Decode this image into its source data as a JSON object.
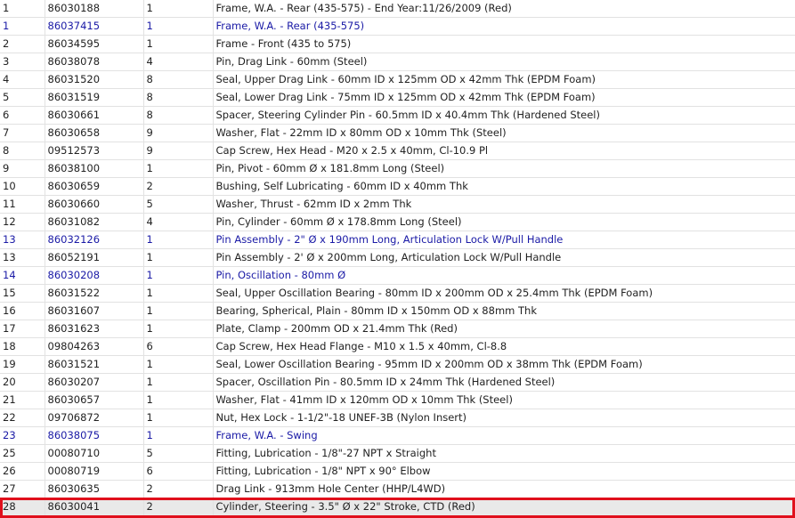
{
  "rows": [
    {
      "ref": "1",
      "part": "86030188",
      "qty": "1",
      "desc": "Frame, W.A. - Rear (435-575) - End Year:11/26/2009 (Red)",
      "linked": false
    },
    {
      "ref": "1",
      "part": "86037415",
      "qty": "1",
      "desc": "Frame, W.A. - Rear (435-575)",
      "linked": true
    },
    {
      "ref": "2",
      "part": "86034595",
      "qty": "1",
      "desc": "Frame - Front (435 to 575)",
      "linked": false
    },
    {
      "ref": "3",
      "part": "86038078",
      "qty": "4",
      "desc": "Pin, Drag Link - 60mm (Steel)",
      "linked": false
    },
    {
      "ref": "4",
      "part": "86031520",
      "qty": "8",
      "desc": "Seal, Upper Drag Link - 60mm ID x 125mm OD x 42mm Thk (EPDM Foam)",
      "linked": false
    },
    {
      "ref": "5",
      "part": "86031519",
      "qty": "8",
      "desc": "Seal, Lower Drag Link - 75mm ID x 125mm OD x 42mm Thk (EPDM Foam)",
      "linked": false
    },
    {
      "ref": "6",
      "part": "86030661",
      "qty": "8",
      "desc": "Spacer, Steering Cylinder Pin - 60.5mm ID x 40.4mm Thk (Hardened Steel)",
      "linked": false
    },
    {
      "ref": "7",
      "part": "86030658",
      "qty": "9",
      "desc": "Washer, Flat - 22mm ID x 80mm OD x 10mm Thk (Steel)",
      "linked": false
    },
    {
      "ref": "8",
      "part": "09512573",
      "qty": "9",
      "desc": "Cap Screw, Hex Head - M20 x 2.5 x 40mm, Cl-10.9 Pl",
      "linked": false
    },
    {
      "ref": "9",
      "part": "86038100",
      "qty": "1",
      "desc": "Pin, Pivot - 60mm Ø x 181.8mm Long (Steel)",
      "linked": false
    },
    {
      "ref": "10",
      "part": "86030659",
      "qty": "2",
      "desc": "Bushing, Self Lubricating - 60mm ID x 40mm Thk",
      "linked": false
    },
    {
      "ref": "11",
      "part": "86030660",
      "qty": "5",
      "desc": "Washer, Thrust - 62mm ID x 2mm Thk",
      "linked": false
    },
    {
      "ref": "12",
      "part": "86031082",
      "qty": "4",
      "desc": "Pin, Cylinder - 60mm Ø x 178.8mm Long (Steel)",
      "linked": false
    },
    {
      "ref": "13",
      "part": "86032126",
      "qty": "1",
      "desc": "Pin Assembly - 2\" Ø x 190mm Long, Articulation Lock W/Pull Handle",
      "linked": true
    },
    {
      "ref": "13",
      "part": "86052191",
      "qty": "1",
      "desc": "Pin Assembly - 2' Ø x 200mm Long, Articulation Lock W/Pull Handle",
      "linked": false
    },
    {
      "ref": "14",
      "part": "86030208",
      "qty": "1",
      "desc": "Pin, Oscillation - 80mm Ø",
      "linked": true
    },
    {
      "ref": "15",
      "part": "86031522",
      "qty": "1",
      "desc": "Seal, Upper Oscillation Bearing - 80mm ID x 200mm OD x 25.4mm Thk (EPDM Foam)",
      "linked": false
    },
    {
      "ref": "16",
      "part": "86031607",
      "qty": "1",
      "desc": "Bearing, Spherical, Plain - 80mm ID x 150mm OD x 88mm Thk",
      "linked": false
    },
    {
      "ref": "17",
      "part": "86031623",
      "qty": "1",
      "desc": "Plate, Clamp - 200mm OD x 21.4mm Thk (Red)",
      "linked": false
    },
    {
      "ref": "18",
      "part": "09804263",
      "qty": "6",
      "desc": "Cap Screw, Hex Head Flange - M10 x 1.5 x 40mm, Cl-8.8",
      "linked": false
    },
    {
      "ref": "19",
      "part": "86031521",
      "qty": "1",
      "desc": "Seal, Lower Oscillation Bearing - 95mm ID x 200mm OD x 38mm Thk (EPDM Foam)",
      "linked": false
    },
    {
      "ref": "20",
      "part": "86030207",
      "qty": "1",
      "desc": "Spacer, Oscillation Pin - 80.5mm ID x 24mm Thk (Hardened Steel)",
      "linked": false
    },
    {
      "ref": "21",
      "part": "86030657",
      "qty": "1",
      "desc": "Washer, Flat - 41mm ID x 120mm OD x 10mm Thk (Steel)",
      "linked": false
    },
    {
      "ref": "22",
      "part": "09706872",
      "qty": "1",
      "desc": "Nut, Hex Lock - 1-1/2\"-18 UNEF-3B (Nylon Insert)",
      "linked": false
    },
    {
      "ref": "23",
      "part": "86038075",
      "qty": "1",
      "desc": "Frame, W.A. - Swing",
      "linked": true
    },
    {
      "ref": "25",
      "part": "00080710",
      "qty": "5",
      "desc": "Fitting, Lubrication - 1/8\"-27 NPT x Straight",
      "linked": false
    },
    {
      "ref": "26",
      "part": "00080719",
      "qty": "6",
      "desc": "Fitting, Lubrication - 1/8\" NPT x 90° Elbow",
      "linked": false
    },
    {
      "ref": "27",
      "part": "86030635",
      "qty": "2",
      "desc": "Drag Link - 913mm Hole Center (HHP/L4WD)",
      "linked": false
    },
    {
      "ref": "28",
      "part": "86030041",
      "qty": "2",
      "desc": "Cylinder, Steering - 3.5\" Ø x 22\" Stroke, CTD (Red)",
      "linked": false
    }
  ],
  "selected_index": 28,
  "colors": {
    "link_text": "#1a1aa6",
    "selection_outline": "#e0101c",
    "selection_fill": "#e9e9e9",
    "grid_line": "#e2e2e2"
  }
}
